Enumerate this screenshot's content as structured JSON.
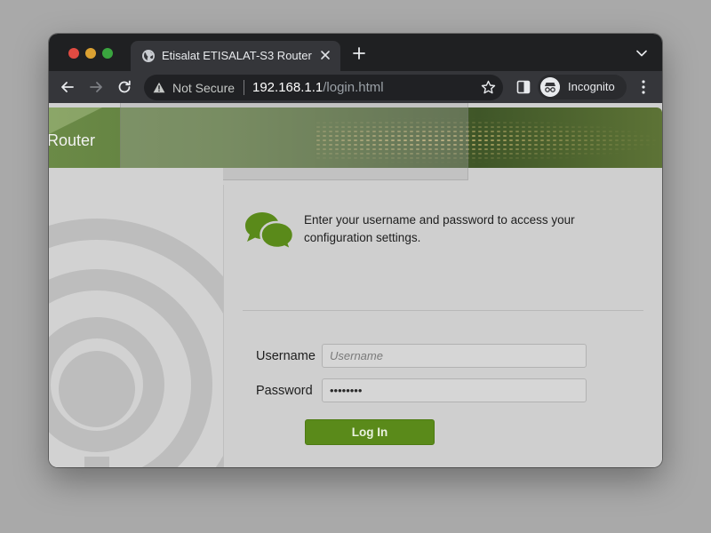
{
  "browser": {
    "tab": {
      "title": "Etisalat ETISALAT-S3 Router",
      "favicon": "globe-icon",
      "close_icon": "close-icon"
    },
    "new_tab_icon": "plus-icon",
    "tab_search_icon": "chevron-down-icon",
    "toolbar": {
      "back_icon": "arrow-left-icon",
      "forward_icon": "arrow-right-icon",
      "reload_icon": "reload-icon",
      "security_icon": "warning-triangle-icon",
      "security_text": "Not Secure",
      "url_host": "192.168.1.1",
      "url_path": "/login.html",
      "bookmark_icon": "star-icon",
      "side_panel_icon": "side-panel-icon",
      "profile_icon": "incognito-icon",
      "profile_label": "Incognito",
      "menu_icon": "kebab-menu-icon"
    },
    "colors": {
      "tabstrip": "#1f2022",
      "toolbar": "#35363a",
      "omnibox": "#202124"
    }
  },
  "page": {
    "banner": {
      "title": "Router"
    },
    "side_graphic": "wifi-icon",
    "intro": {
      "icon": "chat-bubbles-icon",
      "text": "Enter your username and password to access your configuration settings."
    },
    "form": {
      "username_label": "Username",
      "username_value": "",
      "username_placeholder": "Username",
      "password_label": "Password",
      "password_value": "xxxxxxxx",
      "login_button": "Log In"
    },
    "colors": {
      "accent": "#5a8a1a",
      "banner": "#5f7e3d"
    }
  }
}
